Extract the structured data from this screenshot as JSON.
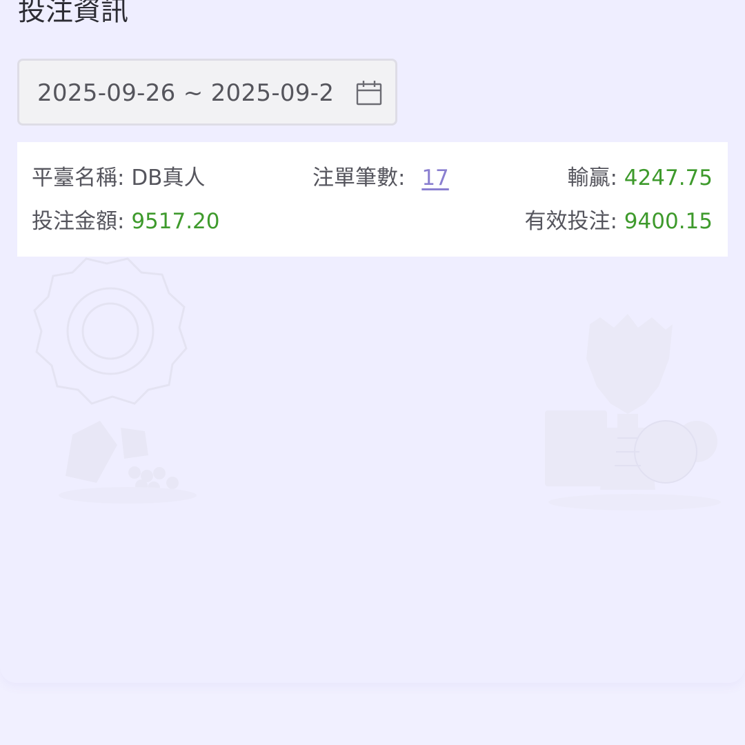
{
  "header": {
    "title": "投注資訊"
  },
  "filter": {
    "date_range": "2025-09-26 ~ 2025-09-2",
    "icon": "calendar-icon"
  },
  "summary": {
    "platform_label": "平臺名稱:",
    "platform_value": "DB真人",
    "count_label": "注單筆數:",
    "count_value": "17",
    "winloss_label": "輸贏:",
    "winloss_value": "4247.75",
    "bet_amount_label": "投注金額:",
    "bet_amount_value": "9517.20",
    "valid_bet_label": "有效投注:",
    "valid_bet_value": "9400.15"
  },
  "colors": {
    "background": "#efeeff",
    "positive_value": "#3e9a2c",
    "link": "#8a7fd0"
  }
}
